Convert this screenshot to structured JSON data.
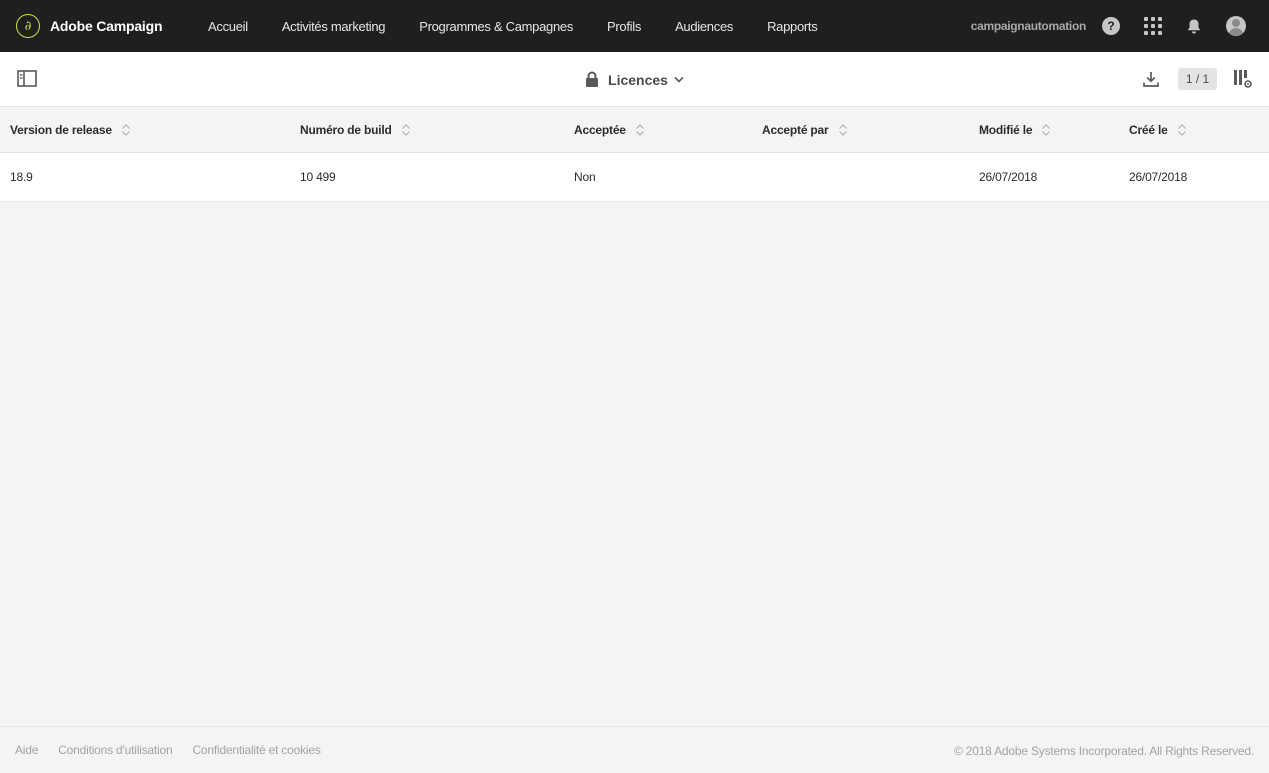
{
  "app": {
    "name": "Adobe Campaign",
    "accent_color": "#c8e34a",
    "logo_icon": "adobe-campaign-logo"
  },
  "nav": {
    "items": [
      {
        "label": "Accueil"
      },
      {
        "label": "Activités marketing"
      },
      {
        "label": "Programmes & Campagnes"
      },
      {
        "label": "Profils"
      },
      {
        "label": "Audiences"
      },
      {
        "label": "Rapports"
      }
    ]
  },
  "user": {
    "name": "campaignautomation",
    "help_icon": "help-icon",
    "apps_icon": "apps-grid-icon",
    "bell_icon": "bell-icon",
    "avatar_icon": "avatar-icon"
  },
  "toolbar": {
    "title": "Licences",
    "pager": "1 / 1"
  },
  "table": {
    "columns": [
      {
        "label": "Version de release"
      },
      {
        "label": "Numéro de build"
      },
      {
        "label": "Acceptée"
      },
      {
        "label": "Accepté par"
      },
      {
        "label": "Modifié le"
      },
      {
        "label": "Créé le"
      }
    ],
    "rows": [
      {
        "cells": [
          "18.9",
          "10 499",
          "Non",
          "",
          "26/07/2018",
          "26/07/2018"
        ]
      }
    ]
  },
  "footer": {
    "links": [
      {
        "label": "Aide"
      },
      {
        "label": "Conditions d'utilisation"
      },
      {
        "label": "Confidentialité et cookies"
      }
    ],
    "copyright": "© 2018 Adobe Systems Incorporated. All Rights Reserved."
  }
}
